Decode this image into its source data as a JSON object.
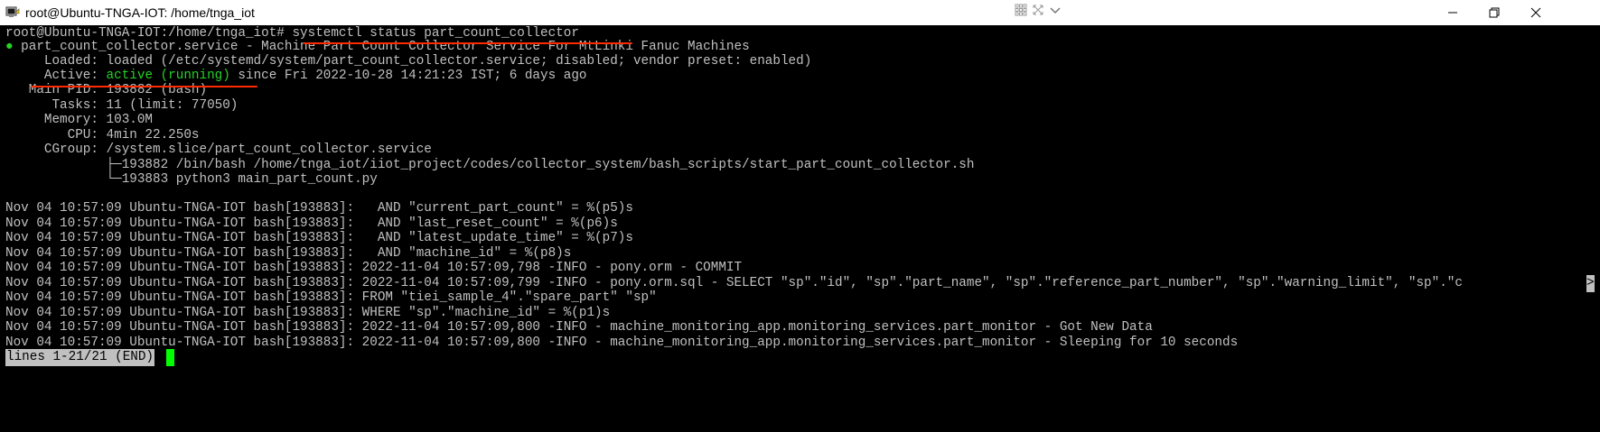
{
  "window": {
    "title": "root@Ubuntu-TNGA-IOT: /home/tnga_iot"
  },
  "terminal": {
    "prompt": "root@Ubuntu-TNGA-IOT:/home/tnga_iot# ",
    "command": "systemctl status part_count_collector",
    "status_bullet": "●",
    "unit_line": " part_count_collector.service - Machine Part Count Collector Service For MtLinki Fanuc Machines",
    "loaded_line": "     Loaded: loaded (/etc/systemd/system/part_count_collector.service; disabled; vendor preset: enabled)",
    "active_label": "     Active: ",
    "active_value": "active (running)",
    "active_rest": " since Fri 2022-10-28 14:21:23 IST; 6 days ago",
    "main_pid": "   Main PID: 193882 (bash)",
    "tasks": "      Tasks: 11 (limit: 77050)",
    "memory": "     Memory: 103.0M",
    "cpu": "        CPU: 4min 22.250s",
    "cgroup": "     CGroup: /system.slice/part_count_collector.service",
    "cgroup_child1": "             ├─193882 /bin/bash /home/tnga_iot/iiot_project/codes/collector_system/bash_scripts/start_part_count_collector.sh",
    "cgroup_child2": "             └─193883 python3 main_part_count.py",
    "log_lines": [
      "Nov 04 10:57:09 Ubuntu-TNGA-IOT bash[193883]:   AND \"current_part_count\" = %(p5)s",
      "Nov 04 10:57:09 Ubuntu-TNGA-IOT bash[193883]:   AND \"last_reset_count\" = %(p6)s",
      "Nov 04 10:57:09 Ubuntu-TNGA-IOT bash[193883]:   AND \"latest_update_time\" = %(p7)s",
      "Nov 04 10:57:09 Ubuntu-TNGA-IOT bash[193883]:   AND \"machine_id\" = %(p8)s",
      "Nov 04 10:57:09 Ubuntu-TNGA-IOT bash[193883]: 2022-11-04 10:57:09,798 -INFO - pony.orm - COMMIT",
      "Nov 04 10:57:09 Ubuntu-TNGA-IOT bash[193883]: 2022-11-04 10:57:09,799 -INFO - pony.orm.sql - SELECT \"sp\".\"id\", \"sp\".\"part_name\", \"sp\".\"reference_part_number\", \"sp\".\"warning_limit\", \"sp\".\"c",
      "Nov 04 10:57:09 Ubuntu-TNGA-IOT bash[193883]: FROM \"tiei_sample_4\".\"spare_part\" \"sp\"",
      "Nov 04 10:57:09 Ubuntu-TNGA-IOT bash[193883]: WHERE \"sp\".\"machine_id\" = %(p1)s",
      "Nov 04 10:57:09 Ubuntu-TNGA-IOT bash[193883]: 2022-11-04 10:57:09,800 -INFO - machine_monitoring_app.monitoring_services.part_monitor - Got New Data",
      "Nov 04 10:57:09 Ubuntu-TNGA-IOT bash[193883]: 2022-11-04 10:57:09,800 -INFO - machine_monitoring_app.monitoring_services.part_monitor - Sleeping for 10 seconds"
    ],
    "truncation_marker": ">",
    "pager_status": "lines 1-21/21 (END)"
  },
  "colors": {
    "running": "#26d326",
    "annotation_underline": "#ff2a00",
    "cursor": "#00ff00"
  }
}
